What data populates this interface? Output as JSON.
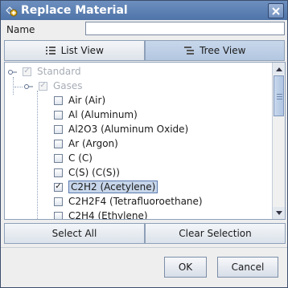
{
  "window": {
    "title": "Replace Material"
  },
  "name_field": {
    "label": "Name",
    "value": ""
  },
  "tabs": [
    {
      "label": "List View",
      "selected": false,
      "icon": "list-icon"
    },
    {
      "label": "Tree View",
      "selected": true,
      "icon": "tree-icon"
    }
  ],
  "tree": {
    "root": {
      "label": "Standard",
      "checked": true,
      "disabled": true
    },
    "group": {
      "label": "Gases",
      "checked": true,
      "disabled": true
    },
    "items": [
      {
        "label": "Air (Air)",
        "checked": false,
        "selected": false
      },
      {
        "label": "Al (Aluminum)",
        "checked": false,
        "selected": false
      },
      {
        "label": "Al2O3 (Aluminum Oxide)",
        "checked": false,
        "selected": false
      },
      {
        "label": "Ar (Argon)",
        "checked": false,
        "selected": false
      },
      {
        "label": "C (C)",
        "checked": false,
        "selected": false
      },
      {
        "label": "C(S) (C(S))",
        "checked": false,
        "selected": false
      },
      {
        "label": "C2H2 (Acetylene)",
        "checked": true,
        "selected": true
      },
      {
        "label": "C2H2F4 (Tetrafluoroethane)",
        "checked": false,
        "selected": false
      },
      {
        "label": "C2H4 (Ethylene)",
        "checked": false,
        "selected": false
      }
    ]
  },
  "buttons": {
    "select_all": "Select All",
    "clear_selection": "Clear Selection",
    "ok": "OK",
    "cancel": "Cancel"
  },
  "colors": {
    "title_bar": "#5a7db0",
    "selected_tab": "#bdd0e8",
    "selection_highlight": "#c7d6ea"
  }
}
